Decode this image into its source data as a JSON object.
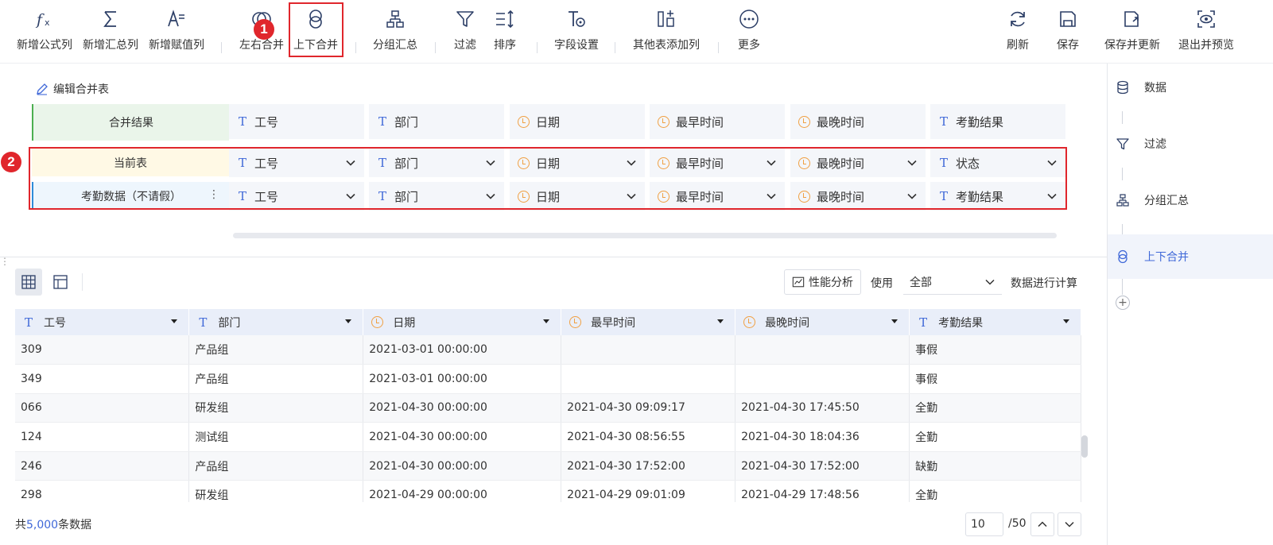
{
  "toolbar": {
    "left_buttons": [
      {
        "label": "新增公式列",
        "icon": "formula-icon"
      },
      {
        "label": "新增汇总列",
        "icon": "sigma-icon"
      },
      {
        "label": "新增赋值列",
        "icon": "assign-icon"
      },
      {
        "label": "左右合并",
        "icon": "left-right-merge-icon"
      },
      {
        "label": "上下合并",
        "icon": "up-down-merge-icon"
      },
      {
        "label": "分组汇总",
        "icon": "group-summary-icon"
      },
      {
        "label": "过滤",
        "icon": "filter-icon"
      },
      {
        "label": "排序",
        "icon": "sort-icon"
      },
      {
        "label": "字段设置",
        "icon": "field-settings-icon"
      },
      {
        "label": "其他表添加列",
        "icon": "add-column-icon"
      },
      {
        "label": "更多",
        "icon": "more-icon"
      }
    ],
    "right_buttons": [
      {
        "label": "刷新",
        "icon": "refresh-icon"
      },
      {
        "label": "保存",
        "icon": "save-icon"
      },
      {
        "label": "保存并更新",
        "icon": "save-update-icon"
      },
      {
        "label": "退出并预览",
        "icon": "exit-preview-icon"
      }
    ],
    "highlight_color": "#e0262c"
  },
  "annotations": {
    "badge1": "1",
    "badge2": "2"
  },
  "merge": {
    "edit_label": "编辑合并表",
    "result_label": "合并结果",
    "current_label": "当前表",
    "source_label": "考勤数据（不请假）",
    "more_dots": "⋮",
    "result_fields": [
      {
        "type": "text",
        "name": "工号"
      },
      {
        "type": "text",
        "name": "部门"
      },
      {
        "type": "date",
        "name": "日期"
      },
      {
        "type": "date",
        "name": "最早时间"
      },
      {
        "type": "date",
        "name": "最晚时间"
      },
      {
        "type": "text",
        "name": "考勤结果"
      }
    ],
    "current_fields": [
      {
        "type": "text",
        "name": "工号"
      },
      {
        "type": "text",
        "name": "部门"
      },
      {
        "type": "date",
        "name": "日期"
      },
      {
        "type": "date",
        "name": "最早时间"
      },
      {
        "type": "date",
        "name": "最晚时间"
      },
      {
        "type": "text",
        "name": "状态"
      }
    ],
    "source_fields": [
      {
        "type": "text",
        "name": "工号"
      },
      {
        "type": "text",
        "name": "部门"
      },
      {
        "type": "date",
        "name": "日期"
      },
      {
        "type": "date",
        "name": "最早时间"
      },
      {
        "type": "date",
        "name": "最晚时间"
      },
      {
        "type": "text",
        "name": "考勤结果"
      }
    ],
    "colors": {
      "result_bg": "#eaf5ea",
      "result_bar": "#4caf50",
      "current_bg": "#fff9e5",
      "source_bg": "#eef6fd",
      "source_bar": "#2f8bd8"
    }
  },
  "sidebar": {
    "steps": [
      {
        "label": "数据",
        "icon": "database-icon",
        "active": false
      },
      {
        "label": "过滤",
        "icon": "filter-icon",
        "active": false
      },
      {
        "label": "分组汇总",
        "icon": "group-summary-icon",
        "active": false
      },
      {
        "label": "上下合并",
        "icon": "up-down-merge-icon",
        "active": true
      }
    ],
    "add_symbol": "+"
  },
  "preview": {
    "perf_label": "性能分析",
    "use_label": "使用",
    "scope_value": "全部",
    "calc_label": "数据进行计算",
    "columns": [
      {
        "type": "text",
        "name": "工号"
      },
      {
        "type": "text",
        "name": "部门"
      },
      {
        "type": "date",
        "name": "日期"
      },
      {
        "type": "date",
        "name": "最早时间"
      },
      {
        "type": "date",
        "name": "最晚时间"
      },
      {
        "type": "text",
        "name": "考勤结果"
      }
    ],
    "rows": [
      [
        "309",
        "产品组",
        "2021-03-01 00:00:00",
        "",
        "",
        "事假"
      ],
      [
        "349",
        "产品组",
        "2021-03-01 00:00:00",
        "",
        "",
        "事假"
      ],
      [
        "066",
        "研发组",
        "2021-04-30 00:00:00",
        "2021-04-30 09:09:17",
        "2021-04-30 17:45:50",
        "全勤"
      ],
      [
        "124",
        "测试组",
        "2021-04-30 00:00:00",
        "2021-04-30 08:56:55",
        "2021-04-30 18:04:36",
        "全勤"
      ],
      [
        "246",
        "产品组",
        "2021-04-30 00:00:00",
        "2021-04-30 17:52:00",
        "2021-04-30 17:52:00",
        "缺勤"
      ],
      [
        "298",
        "研发组",
        "2021-04-29 00:00:00",
        "2021-04-29 09:01:09",
        "2021-04-29 17:48:56",
        "全勤"
      ]
    ]
  },
  "footer": {
    "prefix": "共",
    "count": "5,000",
    "suffix": "条数据",
    "page_value": "10",
    "page_total": "/50"
  },
  "accent": "#3f68d8"
}
